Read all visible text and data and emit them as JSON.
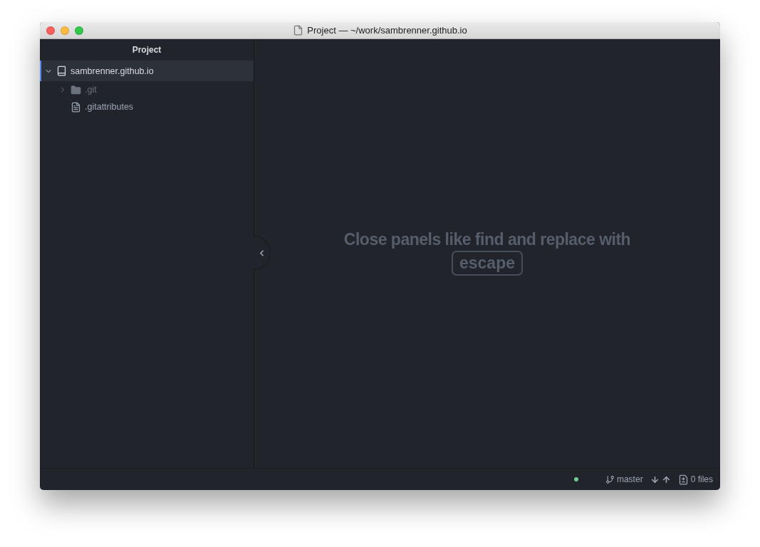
{
  "window": {
    "title": "Project — ~/work/sambrenner.github.io"
  },
  "sidebar": {
    "title": "Project",
    "tree": [
      {
        "kind": "repo",
        "label": "sambrenner.github.io",
        "selected": true,
        "expanded": true,
        "children": [
          {
            "kind": "folder",
            "label": ".git",
            "expanded": false,
            "dimmed": true,
            "selected": false
          },
          {
            "kind": "file",
            "label": ".gitattributes",
            "dimmed": false,
            "selected": false
          }
        ]
      }
    ]
  },
  "hint": {
    "text": "Close panels like find and replace with",
    "key": "escape"
  },
  "status_bar": {
    "status_dot": {
      "color": "#73c990"
    },
    "branch": "master",
    "files": "0 files"
  }
}
